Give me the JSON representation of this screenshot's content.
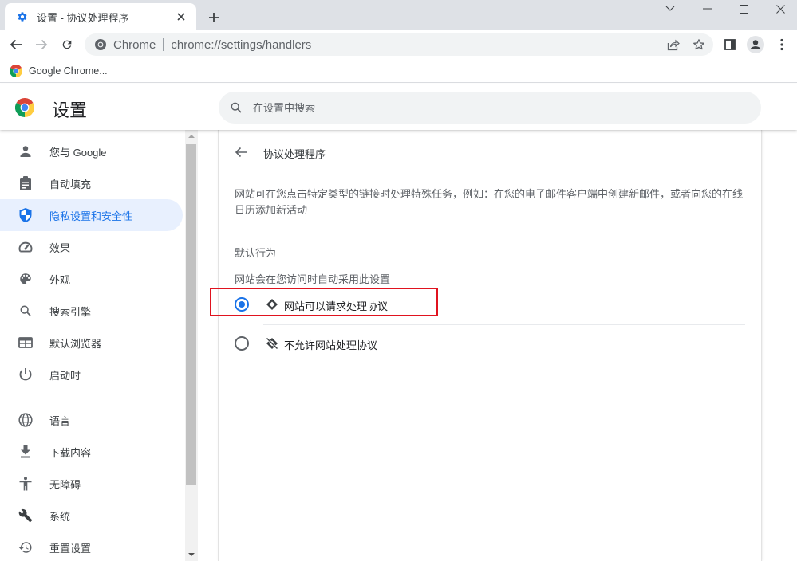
{
  "browser": {
    "tab": {
      "title": "设置 - 协议处理程序",
      "icon": "gear-icon"
    },
    "new_tab_icon": "plus-icon",
    "window_controls": [
      "chevron-down-icon",
      "minimize-icon",
      "maximize-icon",
      "close-icon"
    ],
    "toolbar": {
      "site_chip": "Chrome",
      "url_scheme_host": "chrome://settings",
      "url_path": "/handlers"
    },
    "bookmarks": [
      {
        "label": "Google Chrome...",
        "icon": "chrome-logo-icon"
      }
    ]
  },
  "settings": {
    "title": "设置",
    "search_placeholder": "在设置中搜索",
    "search_value": "",
    "nav": [
      {
        "label": "您与 Google",
        "icon": "person-icon",
        "active": false
      },
      {
        "label": "自动填充",
        "icon": "clipboard-icon",
        "active": false
      },
      {
        "label": "隐私设置和安全性",
        "icon": "shield-icon",
        "active": true
      },
      {
        "label": "效果",
        "icon": "speedometer-icon",
        "active": false
      },
      {
        "label": "外观",
        "icon": "palette-icon",
        "active": false
      },
      {
        "label": "搜索引擎",
        "icon": "search-icon",
        "active": false
      },
      {
        "label": "默认浏览器",
        "icon": "browser-window-icon",
        "active": false
      },
      {
        "label": "启动时",
        "icon": "power-icon",
        "active": false
      },
      {
        "label": "语言",
        "icon": "globe-icon",
        "active": false
      },
      {
        "label": "下载内容",
        "icon": "download-icon",
        "active": false
      },
      {
        "label": "无障碍",
        "icon": "accessibility-icon",
        "active": false
      },
      {
        "label": "系统",
        "icon": "wrench-icon",
        "active": false
      },
      {
        "label": "重置设置",
        "icon": "history-reset-icon",
        "active": false
      }
    ],
    "page": {
      "title": "协议处理程序",
      "description": "网站可在您点击特定类型的链接时处理特殊任务，例如：在您的电子邮件客户端中创建新邮件，或者向您的在线日历添加新活动",
      "default_behavior_label": "默认行为",
      "default_behavior_sub": "网站会在您访问时自动采用此设置",
      "options": [
        {
          "label": "网站可以请求处理协议",
          "icon": "protocol-handler-icon",
          "selected": true
        },
        {
          "label": "不允许网站处理协议",
          "icon": "protocol-handler-off-icon",
          "selected": false
        }
      ],
      "highlight_color": "#e0131f"
    },
    "accent_color": "#1a73e8"
  }
}
